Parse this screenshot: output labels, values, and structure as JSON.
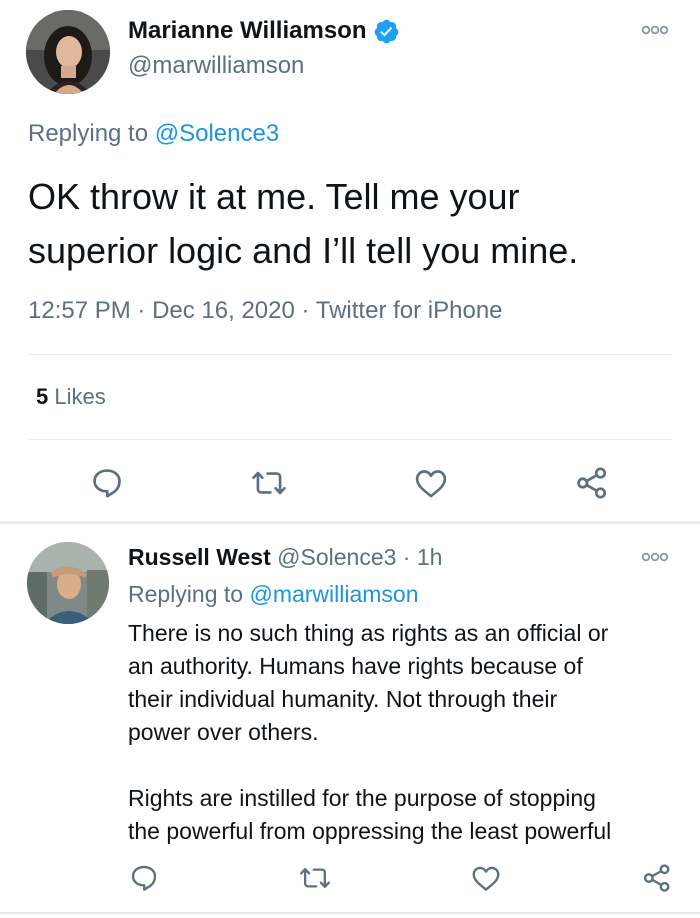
{
  "main_tweet": {
    "author_name": "Marianne Williamson",
    "author_handle": "@marwilliamson",
    "replying_prefix": "Replying to",
    "replying_handle": "@Solence3",
    "text_line1": "OK throw it at me. Tell me your",
    "text_line2": "superior logic and I’ll tell you mine.",
    "time": "12:57 PM",
    "date": "Dec 16, 2020",
    "source": "Twitter for iPhone",
    "sep": "·",
    "likes_count": "5",
    "likes_label": "Likes",
    "icons": [
      "reply-icon",
      "retweet-icon",
      "like-icon",
      "share-icon"
    ]
  },
  "reply_tweet": {
    "author_name": "Russell West",
    "author_handle": "@Solence3",
    "sep": "·",
    "age": "1h",
    "replying_prefix": "Replying to",
    "replying_handle": "@marwilliamson",
    "text_lines": [
      "There is no such thing as rights as an official or",
      "an authority. Humans have rights because of",
      "their individual humanity. Not through their",
      "power over others.",
      "",
      "Rights are instilled for the purpose of stopping",
      "the powerful from oppressing the least powerful"
    ]
  },
  "colors": {
    "accent": "#1da1f2",
    "link": "#1b95e0",
    "muted": "#5b7083",
    "text": "#0f1419",
    "divider": "#e6ecf0"
  }
}
